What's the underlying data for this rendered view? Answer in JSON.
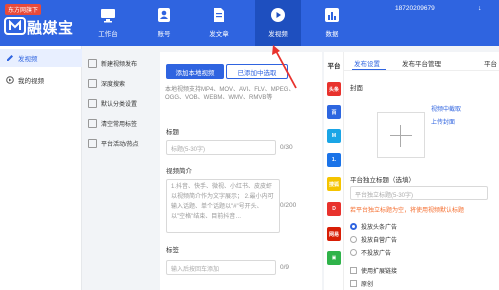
{
  "app": {
    "badge": "东方网旗下",
    "brand": "融媒宝",
    "accent": "#2f64e0",
    "nav": [
      {
        "label": "工作台",
        "icon": "computer-icon"
      },
      {
        "label": "账号",
        "icon": "user-icon"
      },
      {
        "label": "发文章",
        "icon": "document-icon"
      },
      {
        "label": "发视频",
        "icon": "play-icon",
        "active": true
      },
      {
        "label": "数据",
        "icon": "chart-icon"
      }
    ],
    "phone": "18720209679",
    "menu_arrow": "↓"
  },
  "sidebar": {
    "items": [
      {
        "label": "发视频",
        "active": true
      },
      {
        "label": "我的视频",
        "active": false
      }
    ]
  },
  "functions": {
    "items": [
      "新建视频发布",
      "深度搜索",
      "默认分类设置",
      "清空常用标签",
      "平台活动/热点"
    ]
  },
  "form": {
    "add_local_label": "添加本地视频",
    "add_from_library_label": "已添加中选取",
    "formats_hint": "本地视频支持MP4、MOV、AVI、FLV、MPEG、OGG、VOB、WEBM、WMV、RMVB等",
    "title_label": "标题",
    "title_placeholder": "标题(5-30字)",
    "title_count": "0/30",
    "intro_label": "视频简介",
    "intro_placeholder": "1.抖音、快手、微视、小红书、皮皮虾以视频简介作为文字展示；\n2.最小内可输入话题、单个话题以\"#\"号开头、以\"空格\"结束、目前抖音…",
    "intro_count": "0/200",
    "tags_label": "标签",
    "tags_placeholder": "输入后按回车添加",
    "tags_count": "0/9"
  },
  "platforms": {
    "title": "平台",
    "items": [
      {
        "name": "toutiao-icon",
        "color": "#e8322d",
        "glyph": "头条"
      },
      {
        "name": "baijiahao-icon",
        "color": "#2d66e0",
        "glyph": "百"
      },
      {
        "name": "dayu-icon",
        "color": "#1aa5e6",
        "glyph": "M"
      },
      {
        "name": "yidian-icon",
        "color": "#1a73e8",
        "glyph": "1."
      },
      {
        "name": "sohu-icon",
        "color": "#f5c400",
        "glyph": "搜狐"
      },
      {
        "name": "dafeng-icon",
        "color": "#e8322d",
        "glyph": "D"
      },
      {
        "name": "wangyi-icon",
        "color": "#d81e06",
        "glyph": "网易"
      },
      {
        "name": "aiqiyi-icon",
        "color": "#2fb34a",
        "glyph": "▣"
      }
    ]
  },
  "settings": {
    "tabs": [
      "发布设置",
      "发布平台管理",
      "平台"
    ],
    "cover_label": "封面",
    "cover_from_video": "视频中截取",
    "cover_upload": "上传封面",
    "independent_title_label": "平台独立标题（选填）",
    "independent_title_placeholder": "平台独立标题(5-30字)",
    "independent_title_warning": "若平台独立标题为空，将使用视频默认标题",
    "ad_options": [
      "投放头条广告",
      "投放自营广告",
      "不投放广告"
    ],
    "ad_selected_index": 0,
    "checkboxes": [
      "使用扩展链接",
      "原创"
    ]
  }
}
